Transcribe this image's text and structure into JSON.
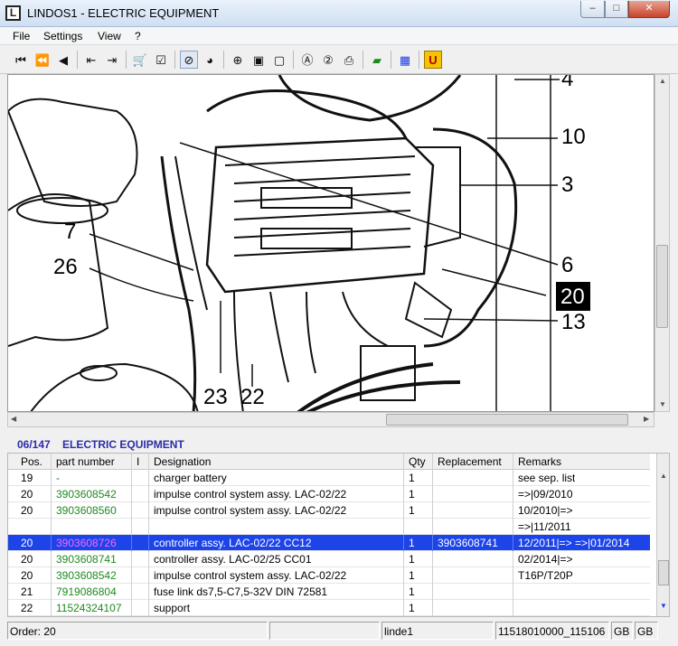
{
  "window": {
    "icon_letter": "L",
    "title": "LINDOS1 - ELECTRIC EQUIPMENT",
    "controls": {
      "minimize": "–",
      "maximize": "□",
      "close": "✕"
    }
  },
  "menu": [
    "File",
    "Settings",
    "View",
    "?"
  ],
  "toolbar": {
    "buttons": [
      {
        "name": "first-page-icon",
        "glyph": "⏮"
      },
      {
        "name": "prev-fast-icon",
        "glyph": "⏪"
      },
      {
        "name": "prev-icon",
        "glyph": "◀"
      },
      {
        "name": "book-back-icon",
        "glyph": "⇤"
      },
      {
        "name": "book-forward-icon",
        "glyph": "⇥"
      },
      {
        "name": "cart-icon",
        "glyph": "🛒"
      },
      {
        "name": "checklist-icon",
        "glyph": "☑"
      },
      {
        "name": "no-filter-icon",
        "glyph": "⊘"
      },
      {
        "name": "globe-icon",
        "glyph": "◕"
      },
      {
        "name": "zoom-in-icon",
        "glyph": "⊕"
      },
      {
        "name": "page-fit-icon",
        "glyph": "▣"
      },
      {
        "name": "page-icon",
        "glyph": "▢"
      },
      {
        "name": "circle-a-icon",
        "glyph": "Ⓐ"
      },
      {
        "name": "circle-2-icon",
        "glyph": "②"
      },
      {
        "name": "print-icon",
        "glyph": "⎙"
      },
      {
        "name": "green-book-icon",
        "glyph": "▰"
      },
      {
        "name": "blue-grid-icon",
        "glyph": "▦"
      },
      {
        "name": "u-icon",
        "glyph": "U"
      }
    ]
  },
  "drawing": {
    "callouts": [
      "4",
      "10",
      "3",
      "7",
      "26",
      "6",
      "20",
      "13",
      "23",
      "22"
    ]
  },
  "section": {
    "code": "06/147",
    "title": "ELECTRIC EQUIPMENT"
  },
  "table": {
    "headers": [
      "Pos.",
      "part number",
      "I",
      "Designation",
      "Qty",
      "Replacement",
      "Remarks"
    ],
    "rows": [
      {
        "pos": "19",
        "part": "-",
        "i": "",
        "designation": "charger battery",
        "qty": "1",
        "replacement": "",
        "remarks": "see sep. list",
        "selected": false
      },
      {
        "pos": "20",
        "part": "3903608542",
        "i": "",
        "designation": "impulse control system assy. LAC-02/22",
        "qty": "1",
        "replacement": "",
        "remarks": "=>|09/2010",
        "selected": false
      },
      {
        "pos": "20",
        "part": "3903608560",
        "i": "",
        "designation": "impulse control system assy. LAC-02/22",
        "qty": "1",
        "replacement": "",
        "remarks": "10/2010|=>",
        "selected": false
      },
      {
        "pos": "",
        "part": "",
        "i": "",
        "designation": "",
        "qty": "",
        "replacement": "",
        "remarks": "=>|11/2011",
        "selected": false
      },
      {
        "pos": "20",
        "part": "3903608726",
        "i": "",
        "designation": "controller assy. LAC-02/22 CC12",
        "qty": "1",
        "replacement": "3903608741",
        "remarks": "12/2011|=> =>|01/2014",
        "selected": true
      },
      {
        "pos": "20",
        "part": "3903608741",
        "i": "",
        "designation": "controller assy. LAC-02/25 CC01",
        "qty": "1",
        "replacement": "",
        "remarks": "02/2014|=>",
        "selected": false
      },
      {
        "pos": "20",
        "part": "3903608542",
        "i": "",
        "designation": "impulse control system assy. LAC-02/22",
        "qty": "1",
        "replacement": "",
        "remarks": "T16P/T20P",
        "selected": false
      },
      {
        "pos": "21",
        "part": "7919086804",
        "i": "",
        "designation": "fuse link ds7,5-C7,5-32V  DIN 72581",
        "qty": "1",
        "replacement": "",
        "remarks": "",
        "selected": false
      },
      {
        "pos": "22",
        "part": "11524324107",
        "i": "",
        "designation": "support",
        "qty": "1",
        "replacement": "",
        "remarks": "",
        "selected": false
      }
    ]
  },
  "status": {
    "order": "Order: 20",
    "blank1": "",
    "user": "linde1",
    "code": "11518010000_115106",
    "lang1": "GB",
    "lang2": "GB"
  }
}
